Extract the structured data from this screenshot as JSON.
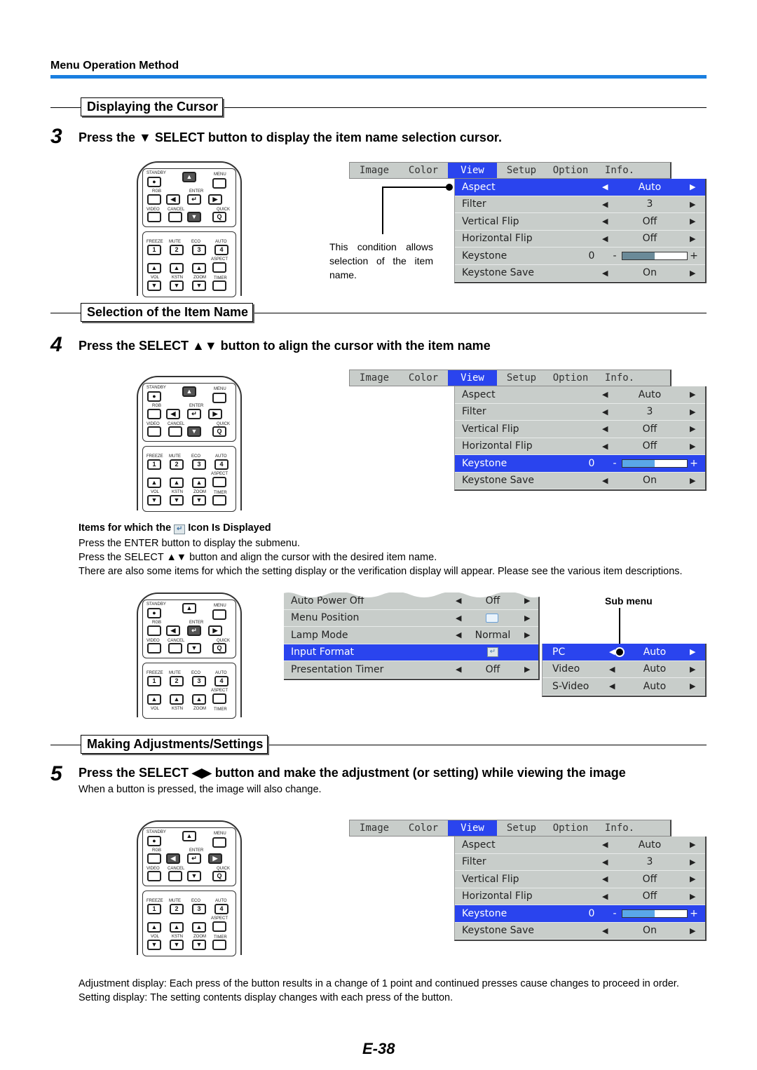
{
  "header": {
    "section_title": "Menu Operation Method",
    "accent_color": "#1a7fe0"
  },
  "sections": [
    {
      "title": "Displaying the Cursor",
      "step_number": "3",
      "step_text": "Press the ▼ SELECT button to display the item name selection cursor."
    },
    {
      "title": "Selection of the Item Name",
      "step_number": "4",
      "step_text": "Press the SELECT ▲▼ button to align the cursor with the item name"
    },
    {
      "title": "Making Adjustments/Settings",
      "step_number": "5",
      "step_text": "Press the SELECT ◀▶ button and make the adjustment (or setting) while viewing the image",
      "step_subtext": "When a button is pressed, the image will also change."
    }
  ],
  "remote": {
    "labels": {
      "standby": "STANDBY",
      "menu": "MENU",
      "rgb": "RGB",
      "enter": "ENTER",
      "video": "VIDEO",
      "cancel": "CANCEL",
      "quick": "QUICK",
      "freeze": "FREEZE",
      "mute": "MUTE",
      "eco": "ECO",
      "auto": "AUTO",
      "aspect": "ASPECT",
      "vol": "VOL",
      "kstn": "KSTN",
      "zoom": "ZOOM",
      "timer": "TIMER"
    },
    "digits": [
      "1",
      "2",
      "3",
      "4"
    ],
    "glyphs": {
      "up": "▲",
      "down": "▼",
      "left": "◀",
      "right": "▶",
      "enter": "↵",
      "dot": "●",
      "quick": "Q"
    }
  },
  "menu": {
    "tabs": [
      "Image",
      "Color",
      "View",
      "Setup",
      "Option",
      "Info."
    ],
    "active_tab": "View",
    "arrow_left": "◀",
    "arrow_right": "▶",
    "rows": [
      {
        "name": "Aspect",
        "value": "Auto"
      },
      {
        "name": "Filter",
        "value": "3"
      },
      {
        "name": "Vertical Flip",
        "value": "Off"
      },
      {
        "name": "Horizontal Flip",
        "value": "Off"
      },
      {
        "name": "Keystone",
        "value": "0",
        "minus": "-",
        "plus": "+",
        "slider_fraction": 0.5
      },
      {
        "name": "Keystone Save",
        "value": "On"
      }
    ]
  },
  "callout1": "This condition allows selection of the item name.",
  "enter_icon_section": {
    "title_pre": "Items for which the",
    "title_post": "Icon Is Displayed",
    "lines": [
      "Press the ENTER button to display the submenu.",
      "Press the SELECT ▲▼ button and align the cursor with the desired item name.",
      "There are also some items for which the setting display or the verification display will appear. Please see the various item descriptions."
    ]
  },
  "setup_menu": {
    "rows": [
      {
        "name": "Auto Power Off",
        "value": "Off"
      },
      {
        "name": "Menu Position",
        "value": ""
      },
      {
        "name": "Lamp Mode",
        "value": "Normal"
      },
      {
        "name": "Input Format",
        "value": "↵"
      },
      {
        "name": "Presentation Timer",
        "value": "Off"
      }
    ],
    "selected": "Input Format"
  },
  "submenu": {
    "label": "Sub menu",
    "rows": [
      {
        "name": "PC",
        "value": "Auto"
      },
      {
        "name": "Video",
        "value": "Auto"
      },
      {
        "name": "S-Video",
        "value": "Auto"
      }
    ],
    "selected": "PC"
  },
  "footer_text": [
    "Adjustment display: Each press of the button results in a change of 1 point and continued presses cause changes to proceed in order.",
    "Setting display: The setting contents display changes with each press of the button."
  ],
  "page_number": "E-38"
}
